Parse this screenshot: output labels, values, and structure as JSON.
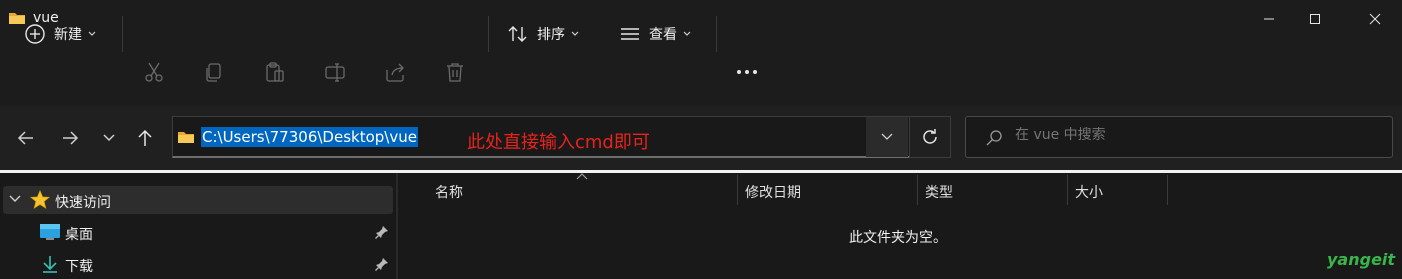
{
  "window": {
    "title": "vue",
    "minimize_icon": "minimize-icon",
    "maximize_icon": "maximize-icon",
    "close_icon": "close-icon"
  },
  "toolbar": {
    "new_label": "新建",
    "sort_label": "排序",
    "view_label": "查看",
    "more_icon": "more-icon"
  },
  "address": {
    "path": "C:\\Users\\77306\\Desktop\\vue",
    "annotation": "此处直接输入cmd即可"
  },
  "search": {
    "placeholder": "在 vue 中搜索"
  },
  "nav": {
    "quick_access": "快速访问",
    "items": [
      {
        "label": "桌面",
        "icon": "desktop-icon"
      },
      {
        "label": "下载",
        "icon": "download-icon"
      }
    ]
  },
  "columns": [
    "名称",
    "修改日期",
    "类型",
    "大小"
  ],
  "content": {
    "empty_message": "此文件夹为空。"
  },
  "watermark": "yangeit",
  "colors": {
    "selection": "#0067c0",
    "annotation": "#e8231c",
    "folder": "#f2c14e",
    "star": "#f7c331",
    "watermark": "#39b54a"
  }
}
